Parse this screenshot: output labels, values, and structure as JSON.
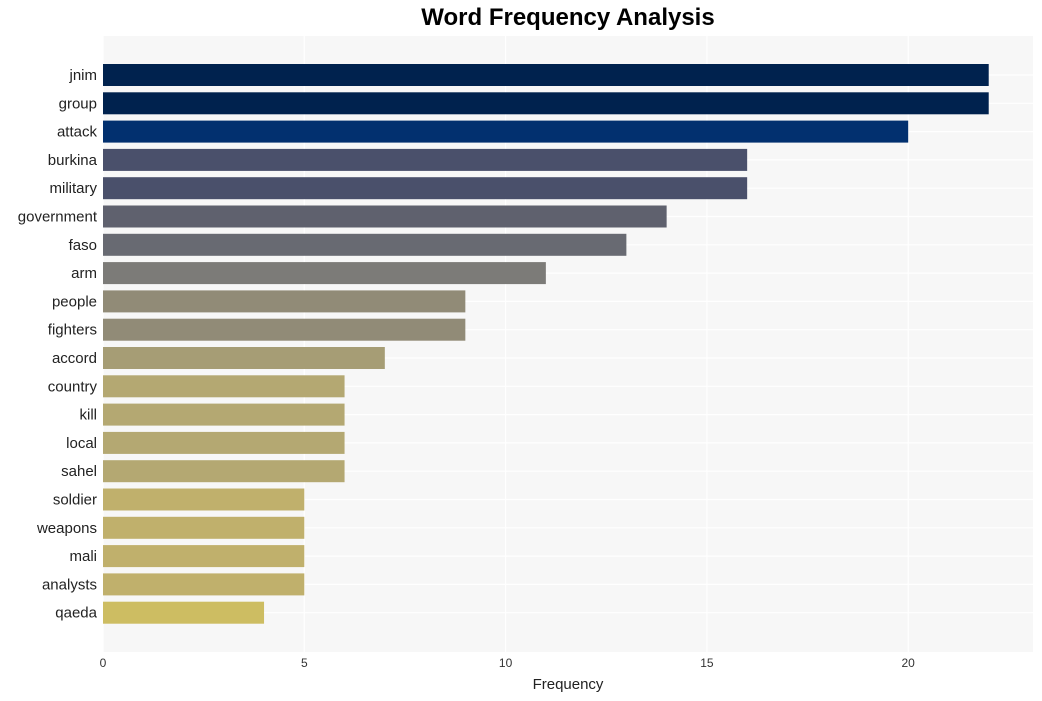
{
  "chart_data": {
    "type": "bar",
    "orientation": "horizontal",
    "title": "Word Frequency Analysis",
    "xlabel": "Frequency",
    "ylabel": "",
    "xlim": [
      0,
      23.1
    ],
    "xticks": [
      0,
      5,
      10,
      15,
      20
    ],
    "grid": true,
    "legend": null,
    "categories": [
      "jnim",
      "group",
      "attack",
      "burkina",
      "military",
      "government",
      "faso",
      "arm",
      "people",
      "fighters",
      "accord",
      "country",
      "kill",
      "local",
      "sahel",
      "soldier",
      "weapons",
      "mali",
      "analysts",
      "qaeda"
    ],
    "values": [
      22,
      22,
      20,
      16,
      16,
      14,
      13,
      11,
      9,
      9,
      7,
      6,
      6,
      6,
      6,
      5,
      5,
      5,
      5,
      4
    ],
    "colors": [
      "#00224e",
      "#00224e",
      "#02306f",
      "#4a506b",
      "#4a506b",
      "#5f616e",
      "#686a72",
      "#7c7b78",
      "#918b77",
      "#918b77",
      "#a69d75",
      "#b4a872",
      "#b4a872",
      "#b4a872",
      "#b4a872",
      "#c0b06c",
      "#c0b06c",
      "#c0b06c",
      "#c0b06c",
      "#cdbd62"
    ],
    "background_color": "#f7f7f7"
  }
}
